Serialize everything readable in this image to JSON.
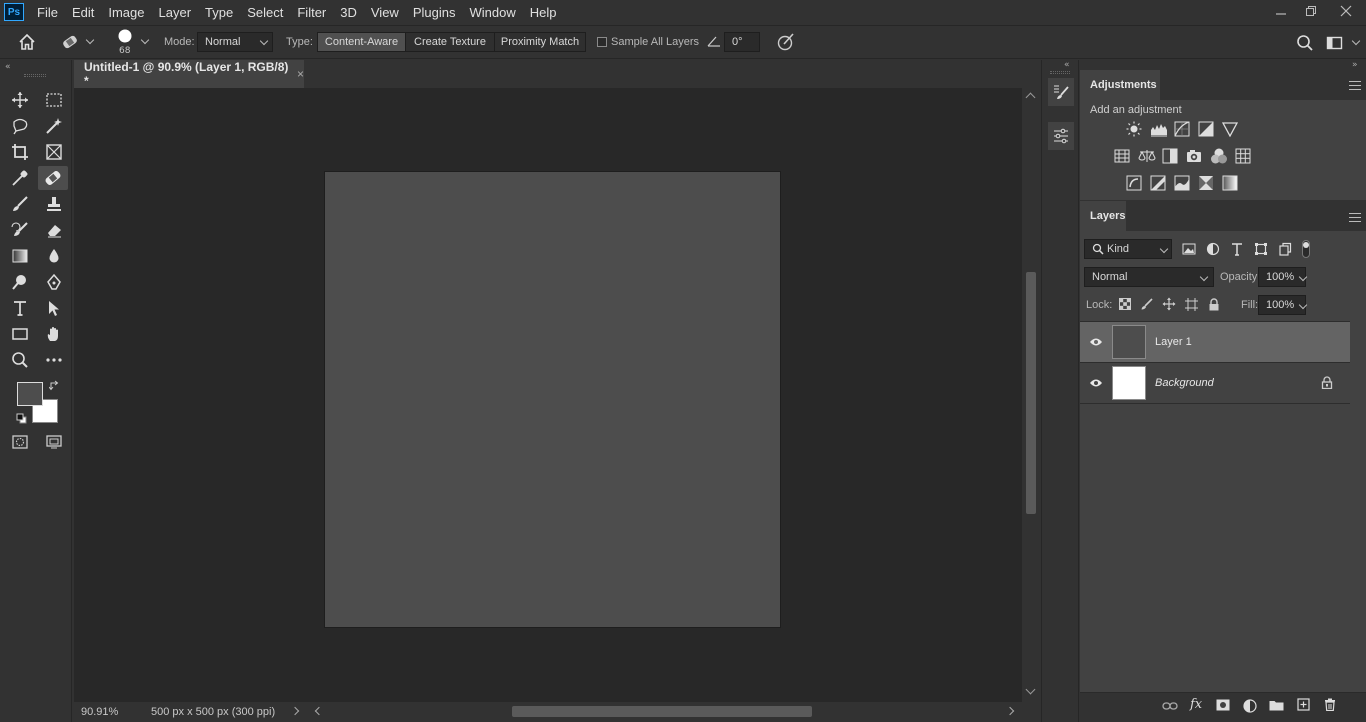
{
  "app": {
    "logo_text": "Ps"
  },
  "menu": [
    "File",
    "Edit",
    "Image",
    "Layer",
    "Type",
    "Select",
    "Filter",
    "3D",
    "View",
    "Plugins",
    "Window",
    "Help"
  ],
  "options": {
    "brush_size": "68",
    "mode_label": "Mode:",
    "mode_value": "Normal",
    "type_label": "Type:",
    "type_buttons": [
      "Content-Aware",
      "Create Texture",
      "Proximity Match"
    ],
    "sample_all_layers": "Sample All Layers",
    "angle_value": "0°"
  },
  "document": {
    "tab_title": "Untitled-1 @ 90.9% (Layer 1, RGB/8) *",
    "close_glyph": "×",
    "zoom": "90.91%",
    "doc_info": "500 px x 500 px (300 ppi)",
    "canvas_color": "#4d4d4d"
  },
  "adjustments": {
    "tab": "Adjustments",
    "subtitle": "Add an adjustment"
  },
  "layers": {
    "tab": "Layers",
    "filter_kind": "Kind",
    "blend_mode": "Normal",
    "opacity_label": "Opacity:",
    "opacity_value": "100%",
    "lock_label": "Lock:",
    "fill_label": "Fill:",
    "fill_value": "100%",
    "items": [
      {
        "name": "Layer 1",
        "selected": true,
        "thumb_color": "#4d4d4d",
        "locked": false
      },
      {
        "name": "Background",
        "selected": false,
        "thumb_color": "#ffffff",
        "locked": true
      }
    ]
  }
}
